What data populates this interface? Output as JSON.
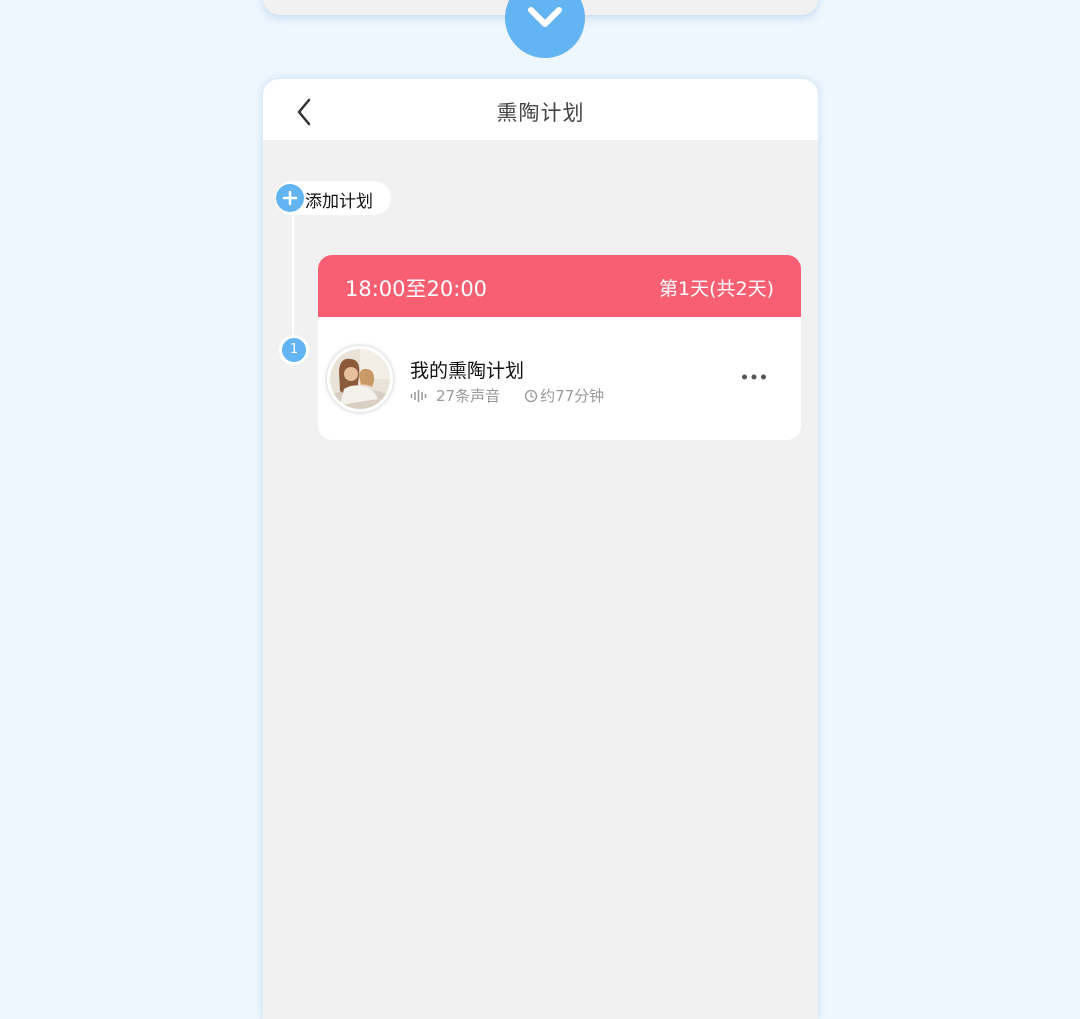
{
  "screen": {
    "title": "熏陶计划"
  },
  "timeline": {
    "add_label": "添加计划",
    "step_number": "1"
  },
  "plan": {
    "time_range": "18:00至20:00",
    "day_info": "第1天(共2天)",
    "item": {
      "title": "我的熏陶计划",
      "sound_count": "27条声音",
      "duration": "约77分钟"
    }
  },
  "icons": {
    "expand": "chevron-down-icon",
    "back": "chevron-left-icon",
    "add": "plus-icon",
    "sound": "sound-wave-icon",
    "clock": "clock-icon",
    "more": "more-dots-icon"
  },
  "colors": {
    "accent_blue": "#62b4f2",
    "header_red": "#f85f73",
    "page_bg": "#eef6fe",
    "content_bg": "#f1f1f1"
  }
}
